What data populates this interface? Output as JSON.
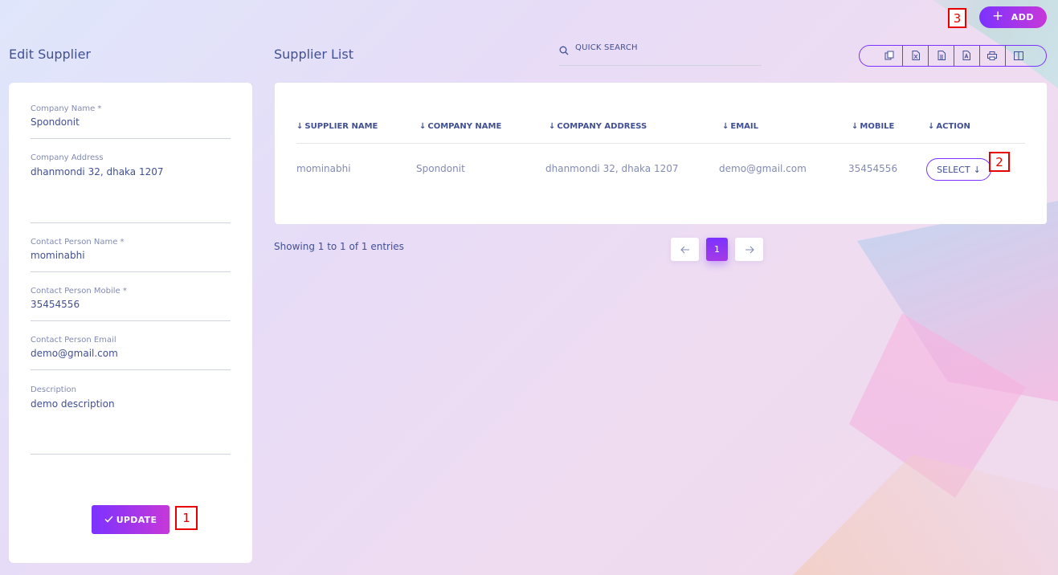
{
  "left_panel": {
    "title": "Edit Supplier",
    "fields": [
      {
        "label": "Company Name *",
        "value": "Spondonit"
      },
      {
        "label": "Company Address",
        "value": "dhanmondi 32, dhaka 1207"
      },
      {
        "label": "Contact Person Name *",
        "value": "mominabhi"
      },
      {
        "label": "Contact Person Mobile *",
        "value": "35454556"
      },
      {
        "label": "Contact Person Email",
        "value": "demo@gmail.com"
      },
      {
        "label": "Description",
        "value": "demo description"
      }
    ],
    "update_label": "UPDATE"
  },
  "main": {
    "title": "Supplier List",
    "search_placeholder": "QUICK SEARCH",
    "add_label": "ADD",
    "toolbar_icons": [
      "copy-icon",
      "excel-icon",
      "csv-icon",
      "pdf-icon",
      "print-icon",
      "columns-icon"
    ],
    "table": {
      "columns": [
        "SUPPLIER NAME",
        "COMPANY NAME",
        "COMPANY ADDRESS",
        "EMAIL",
        "MOBILE",
        "ACTION"
      ],
      "rows": [
        {
          "supplier_name": "mominabhi",
          "company_name": "Spondonit",
          "company_address": "dhanmondi 32, dhaka 1207",
          "email": "demo@gmail.com",
          "mobile": "35454556",
          "action_label": "SELECT"
        }
      ]
    },
    "entries_info": "Showing 1 to 1 of 1 entries",
    "pagination": {
      "current_page": "1"
    }
  },
  "markers": [
    "1",
    "2",
    "3"
  ],
  "colors": {
    "accent": "#7c32ff",
    "accent_end": "#c738d8",
    "text": "#415094",
    "muted": "#828bb2",
    "marker": "#e60000"
  }
}
